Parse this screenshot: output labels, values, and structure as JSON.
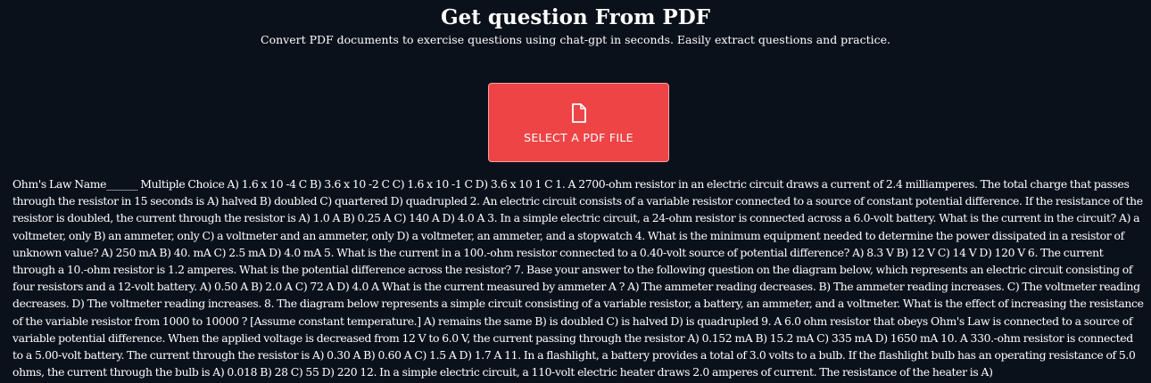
{
  "header": {
    "title": "Get question From PDF",
    "subtitle": "Convert PDF documents to exercise questions using chat-gpt in seconds. Easily extract questions and practice."
  },
  "upload": {
    "icon": "file-icon",
    "label": "SELECT A PDF FILE",
    "color": "#ee4446"
  },
  "content": {
    "text": "Ohm's Law Name______ Multiple Choice A) 1.6 x 10 -4 C B) 3.6 x 10 -2 C C) 1.6 x 10 -1 C D) 3.6 x 10 1 C 1. A 2700-ohm resistor in an electric circuit draws a current of 2.4 milliamperes. The total charge that passes through the resistor in 15 seconds is A) halved B) doubled C) quartered D) quadrupled 2. An electric circuit consists of a variable resistor connected to a source of constant potential difference. If the resistance of the resistor is doubled, the current through the resistor is A) 1.0 A B) 0.25 A C) 140 A D) 4.0 A 3. In a simple electric circuit, a 24-ohm resistor is connected across a 6.0-volt battery. What is the current in the circuit? A) a voltmeter, only B) an ammeter, only C) a voltmeter and an ammeter, only D) a voltmeter, an ammeter, and a stopwatch 4. What is the minimum equipment needed to determine the power dissipated in a resistor of unknown value? A) 250 mA B) 40. mA C) 2.5 mA D) 4.0 mA 5. What is the current in a 100.-ohm resistor connected to a 0.40-volt source of potential difference? A) 8.3 V B) 12 V C) 14 V D) 120 V 6. The current through a 10.-ohm resistor is 1.2 amperes. What is the potential difference across the resistor? 7. Base your answer to the following question on the diagram below, which represents an electric circuit consisting of four resistors and a 12-volt battery. A) 0.50 A B) 2.0 A C) 72 A D) 4.0 A What is the current measured by ammeter A ? A) The ammeter reading decreases. B) The ammeter reading increases. C) The voltmeter reading decreases. D) The voltmeter reading increases. 8. The diagram below represents a simple circuit consisting of a variable resistor, a battery, an ammeter, and a voltmeter. What is the effect of increasing the resistance of the variable resistor from 1000 to 10000 ? [Assume constant temperature.] A) remains the same B) is doubled C) is halved D) is quadrupled 9. A 6.0 ohm resistor that obeys Ohm's Law is connected to a source of variable potential difference. When the applied voltage is decreased from 12 V to 6.0 V, the current passing through the resistor A) 0.152 mA B) 15.2 mA C) 335 mA D) 1650 mA 10. A 330.-ohm resistor is connected to a 5.00-volt battery. The current through the resistor is A) 0.30 A B) 0.60 A C) 1.5 A D) 1.7 A 11. In a flashlight, a battery provides a total of 3.0 volts to a bulb. If the flashlight bulb has an operating resistance of 5.0 ohms, the current through the bulb is A) 0.018 B) 28 C) 55 D) 220 12. In a simple electric circuit, a 110-volt electric heater draws 2.0 amperes of current. The resistance of the heater is A)"
  }
}
